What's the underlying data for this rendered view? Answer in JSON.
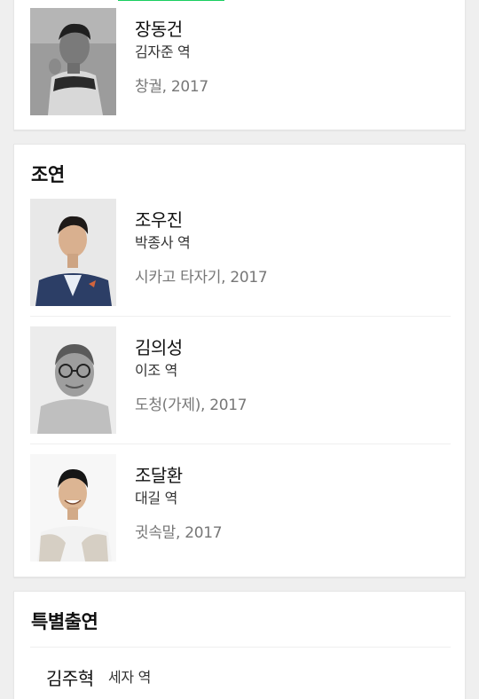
{
  "top_card": {
    "cast": {
      "name": "장동건",
      "role": "김자준 역",
      "work": "창궐, 2017",
      "photo": "actor-portrait-bw"
    }
  },
  "supporting": {
    "title": "조연",
    "cast": [
      {
        "name": "조우진",
        "role": "박종사 역",
        "work": "시카고 타자기, 2017",
        "photo": "actor-portrait-suit"
      },
      {
        "name": "김의성",
        "role": "이조 역",
        "work": "도청(가제), 2017",
        "photo": "actor-portrait-glasses"
      },
      {
        "name": "조달환",
        "role": "대길 역",
        "work": "귓속말, 2017",
        "photo": "actor-portrait-smile"
      }
    ]
  },
  "special": {
    "title": "특별출연",
    "cast": [
      {
        "name": "김주혁",
        "role": "세자 역"
      }
    ]
  },
  "colors": {
    "background": "#efefef",
    "card": "#ffffff",
    "accent": "#19ce60",
    "text_primary": "#111111",
    "text_secondary": "#777777"
  }
}
